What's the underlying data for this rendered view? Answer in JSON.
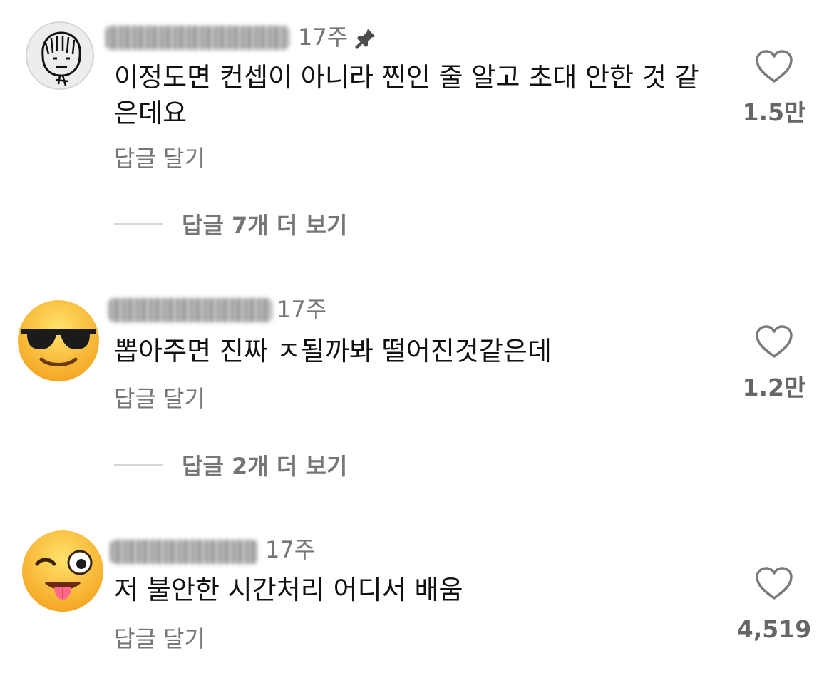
{
  "comments": [
    {
      "time": "17주",
      "text": "이정도면 컨셉이 아니라 찐인 줄 알고 초대 안한 것 같은데요",
      "reply_label": "답글 달기",
      "more_replies": "답글 7개 더 보기",
      "likes": "1.5만",
      "pinned": true,
      "avatar_icon": "sketch-face-icon"
    },
    {
      "time": "17주",
      "text": "뽑아주면 진짜 ㅈ될까봐 떨어진것같은데",
      "reply_label": "답글 달기",
      "more_replies": "답글 2개 더 보기",
      "likes": "1.2만",
      "avatar_icon": "sunglasses-emoji-icon"
    },
    {
      "time": "17주",
      "text": "저 불안한 시간처리 어디서 배움",
      "reply_label": "답글 달기",
      "likes": "4,519",
      "avatar_icon": "winking-tongue-emoji-icon"
    }
  ],
  "colors": {
    "text": "#111111",
    "secondary": "#767676",
    "divider": "#d7d7d7"
  }
}
